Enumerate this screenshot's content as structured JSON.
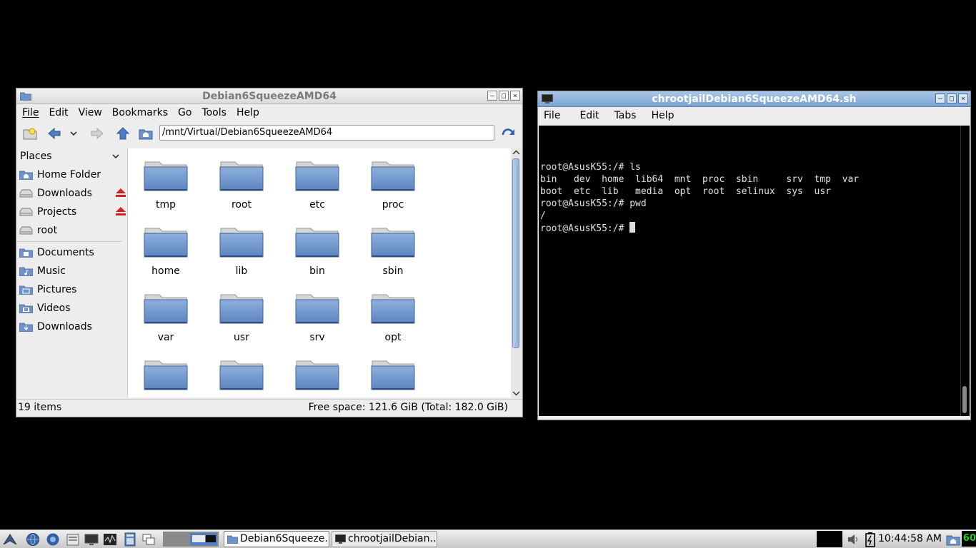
{
  "file_manager": {
    "title": "Debian6SqueezeAMD64",
    "menu": [
      "File",
      "Edit",
      "View",
      "Bookmarks",
      "Go",
      "Tools",
      "Help"
    ],
    "address": "/mnt/Virtual/Debian6SqueezeAMD64",
    "places_header": "Places",
    "places": [
      {
        "label": "Home Folder",
        "icon": "home-folder-icon"
      },
      {
        "label": "Downloads",
        "icon": "drive-icon",
        "eject": true
      },
      {
        "label": "Projects",
        "icon": "drive-icon",
        "eject": true
      },
      {
        "label": "root",
        "icon": "drive-icon"
      }
    ],
    "bookmarks": [
      {
        "label": "Documents",
        "icon": "documents-folder-icon"
      },
      {
        "label": "Music",
        "icon": "music-folder-icon"
      },
      {
        "label": "Pictures",
        "icon": "pictures-folder-icon"
      },
      {
        "label": "Videos",
        "icon": "videos-folder-icon"
      },
      {
        "label": "Downloads",
        "icon": "downloads-folder-icon"
      }
    ],
    "folders": [
      "tmp",
      "root",
      "etc",
      "proc",
      "home",
      "lib",
      "bin",
      "sbin",
      "var",
      "usr",
      "srv",
      "opt",
      "",
      "",
      "",
      ""
    ],
    "status_items": "19 items",
    "status_space": "Free space: 121.6 GiB (Total: 182.0 GiB)"
  },
  "terminal": {
    "title": "chrootjailDebian6SqueezeAMD64.sh",
    "menu": [
      "File",
      "Edit",
      "Tabs",
      "Help"
    ],
    "lines": [
      "root@AsusK55:/# ls",
      "bin   dev  home  lib64  mnt  proc  sbin     srv  tmp  var",
      "boot  etc  lib   media  opt  root  selinux  sys  usr",
      "root@AsusK55:/# pwd",
      "/"
    ],
    "prompt": "root@AsusK55:/# "
  },
  "taskbar": {
    "tasks": [
      {
        "label": "Debian6Squeeze...",
        "active": true
      },
      {
        "label": "chrootjailDebian...",
        "active": false
      }
    ],
    "clock": "10:44:58 AM",
    "cpu": "60"
  },
  "colors": {
    "folder": "#6f93c9",
    "terminal_title": "#7aa3d2",
    "eject": "#d42020"
  }
}
